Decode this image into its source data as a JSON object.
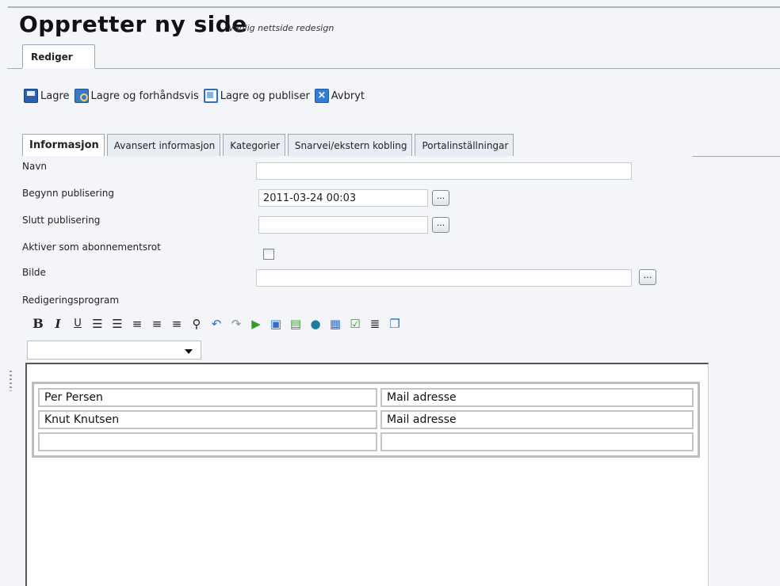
{
  "header": {
    "title": "Oppretter ny side",
    "subtitle": "Vanlig nettside redesign"
  },
  "edit_tab": {
    "label": "Rediger"
  },
  "toolbar": {
    "save": "Lagre",
    "save_preview": "Lagre og forhåndsvis",
    "save_publish": "Lagre og publiser",
    "cancel": "Avbryt"
  },
  "tabs": [
    {
      "label": "Informasjon",
      "active": true
    },
    {
      "label": "Avansert informasjon"
    },
    {
      "label": "Kategorier"
    },
    {
      "label": "Snarvei/ekstern kobling"
    },
    {
      "label": "Portalinställningar"
    }
  ],
  "form": {
    "name_label": "Navn",
    "name_value": "",
    "start_label": "Begynn publisering",
    "start_value": "2011-03-24 00:03",
    "end_label": "Slutt publisering",
    "end_value": "",
    "subscription_label": "Aktiver som abonnementsrot",
    "subscription_checked": false,
    "image_label": "Bilde",
    "image_value": "",
    "editor_label": "Redigeringsprogram",
    "dots": "..."
  },
  "editor_toolbar": [
    "B",
    "I",
    "U"
  ],
  "format_select": {
    "value": ""
  },
  "table_rows": [
    [
      "Per Persen",
      "Mail adresse"
    ],
    [
      "Knut Knutsen",
      "Mail adresse"
    ],
    [
      "",
      ""
    ]
  ]
}
